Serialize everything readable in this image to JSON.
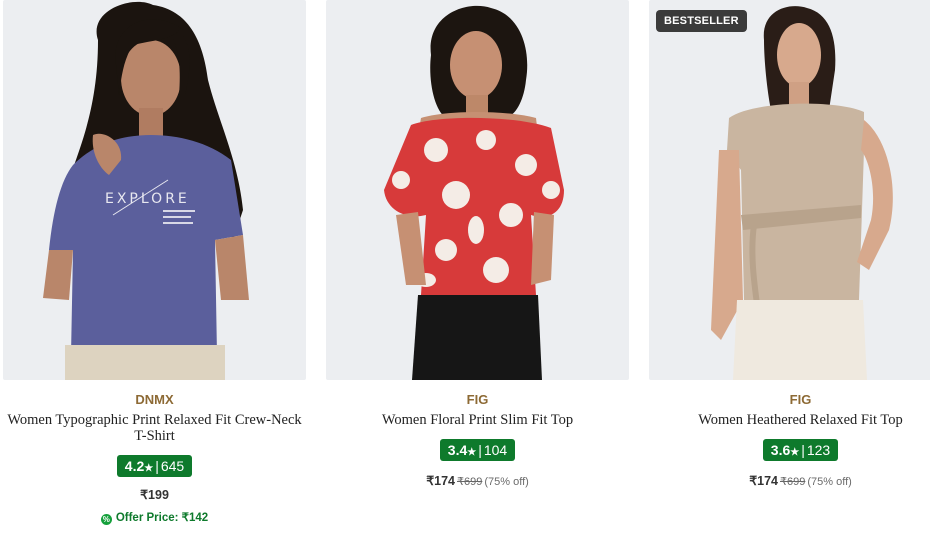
{
  "products": [
    {
      "brand": "DNMX",
      "title": "Women Typographic Print Relaxed Fit Crew-Neck T-Shirt",
      "rating": "4.2",
      "rating_count": "645",
      "price": "₹199",
      "offer_price": "Offer Price: ₹142"
    },
    {
      "brand": "FIG",
      "title": "Women Floral Print Slim Fit Top",
      "rating": "3.4",
      "rating_count": "104",
      "price": "₹174",
      "mrp": "₹699",
      "discount": "(75% off)"
    },
    {
      "badge": "BESTSELLER",
      "brand": "FIG",
      "title": "Women Heathered Relaxed Fit Top",
      "rating": "3.6",
      "rating_count": "123",
      "price": "₹174",
      "mrp": "₹699",
      "discount": "(75% off)"
    }
  ],
  "tshirt_print": "EXPLORE",
  "colors": {
    "brand_text": "#8d6a35",
    "rating_bg": "#0e7a2c",
    "badge_bg": "#3b3b3b"
  }
}
